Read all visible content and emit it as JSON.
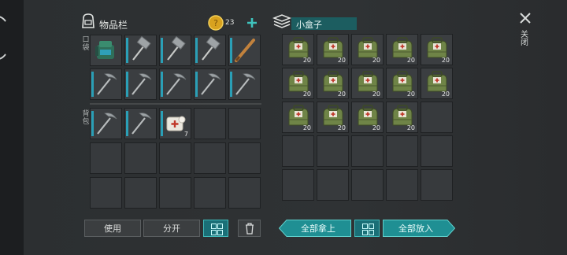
{
  "inventory": {
    "title": "物品栏",
    "coins": "23",
    "pocket_label": "口袋",
    "backpack_label": "背包"
  },
  "container": {
    "title": "小盒子"
  },
  "close": {
    "label": "关闭"
  },
  "buttons": {
    "use": "使用",
    "split": "分开",
    "take_all": "全部拿上",
    "put_all": "全部放入"
  },
  "items": {
    "pocket": [
      {
        "icon": "backpack-icon",
        "count": ""
      },
      {
        "icon": "sledgehammer-icon",
        "count": ""
      },
      {
        "icon": "sledgehammer-icon",
        "count": ""
      },
      {
        "icon": "sledgehammer-icon",
        "count": ""
      },
      {
        "icon": "baseball-bat-icon",
        "count": ""
      },
      {
        "icon": "pickaxe-icon",
        "count": ""
      },
      {
        "icon": "pickaxe-icon",
        "count": ""
      },
      {
        "icon": "pickaxe-icon",
        "count": ""
      },
      {
        "icon": "pickaxe-icon",
        "count": ""
      },
      {
        "icon": "pickaxe-icon",
        "count": ""
      }
    ],
    "backpack": [
      {
        "icon": "pickaxe-icon",
        "count": ""
      },
      {
        "icon": "pickaxe-icon",
        "count": ""
      },
      {
        "icon": "bandage-icon",
        "count": "7"
      }
    ],
    "container": [
      {
        "icon": "medical-bag-icon",
        "count": "20"
      },
      {
        "icon": "medical-bag-icon",
        "count": "20"
      },
      {
        "icon": "medical-bag-icon",
        "count": "20"
      },
      {
        "icon": "medical-bag-icon",
        "count": "20"
      },
      {
        "icon": "medical-bag-icon",
        "count": "20"
      },
      {
        "icon": "medical-bag-icon",
        "count": "20"
      },
      {
        "icon": "medical-bag-icon",
        "count": "20"
      },
      {
        "icon": "medical-bag-icon",
        "count": "20"
      },
      {
        "icon": "medical-bag-icon",
        "count": "20"
      },
      {
        "icon": "medical-bag-icon",
        "count": "20"
      },
      {
        "icon": "medical-bag-icon",
        "count": "20"
      },
      {
        "icon": "medical-bag-icon",
        "count": "20"
      },
      {
        "icon": "medical-bag-icon",
        "count": "20"
      },
      {
        "icon": "medical-bag-icon",
        "count": "20"
      }
    ]
  },
  "colors": {
    "accent": "#1f8f93",
    "slot": "#373a3d",
    "coin": "#d8a21f"
  }
}
